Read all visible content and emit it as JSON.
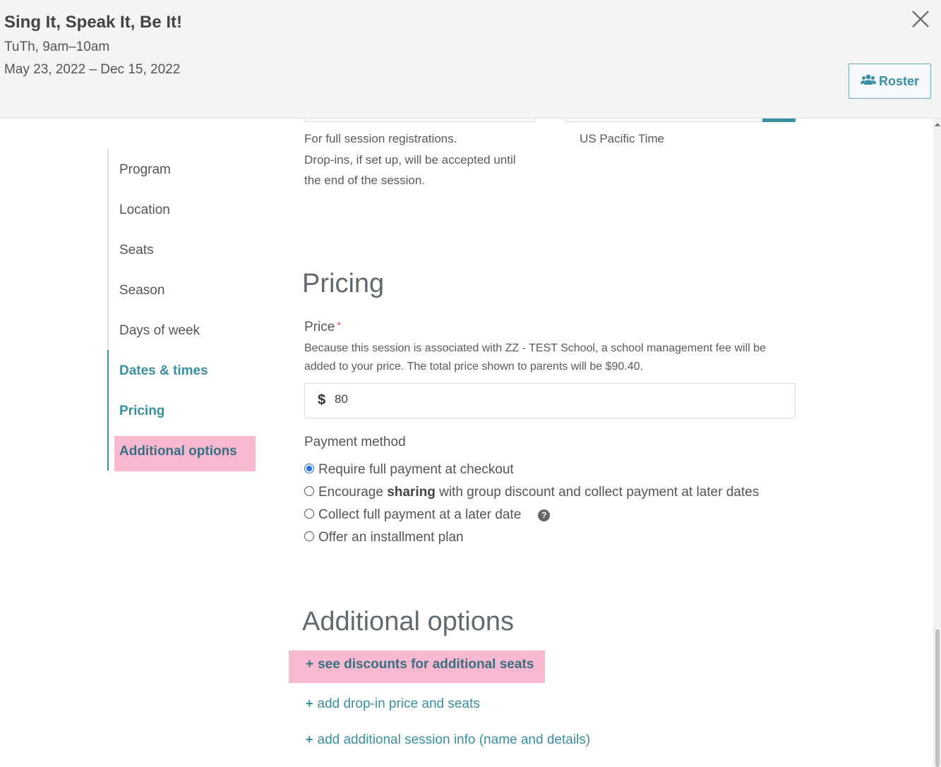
{
  "header": {
    "title": "Sing It, Speak It, Be It!",
    "schedule": "TuTh, 9am–10am",
    "dates": "May 23, 2022 – Dec 15, 2022",
    "roster_label": "Roster",
    "close_icon": "close-icon",
    "roster_icon": "users-icon"
  },
  "top_fields": {
    "left_help_1": "For full session registrations.",
    "left_help_2": "Drop-ins, if set up, will be accepted until",
    "left_help_3": "the end of the session.",
    "right_help": "US Pacific Time"
  },
  "nav": {
    "items": [
      {
        "label": "Program",
        "state": "normal"
      },
      {
        "label": "Location",
        "state": "normal"
      },
      {
        "label": "Seats",
        "state": "normal"
      },
      {
        "label": "Season",
        "state": "normal"
      },
      {
        "label": "Days of week",
        "state": "normal"
      },
      {
        "label": "Dates & times",
        "state": "done"
      },
      {
        "label": "Pricing",
        "state": "done"
      },
      {
        "label": "Additional options",
        "state": "current"
      }
    ]
  },
  "pricing": {
    "heading": "Pricing",
    "price_label": "Price",
    "required_mark": "*",
    "note": "Because this session is associated with ZZ - TEST School, a school management fee will be added to your price. The total price shown to parents will be $90.40.",
    "currency": "$",
    "price_value": "80",
    "payment_method_label": "Payment method",
    "options": {
      "opt1": "Require full payment at checkout",
      "opt2_pre": "Encourage",
      "opt2_bold": "sharing",
      "opt2_post": "with group discount and collect payment at later dates",
      "opt3": "Collect full payment at a later date",
      "opt4": "Offer an installment plan"
    },
    "selected": "Require full payment at checkout",
    "help_icon": "?"
  },
  "additional": {
    "heading": "Additional options",
    "plus": "+",
    "link1": "see discounts for additional seats",
    "link2": "add drop-in price and seats",
    "link3": "add additional session info (name and details)"
  },
  "colors": {
    "accent": "#3a8fa3",
    "highlight": "#f7b8d0",
    "header_bg": "#f4f4f4"
  }
}
